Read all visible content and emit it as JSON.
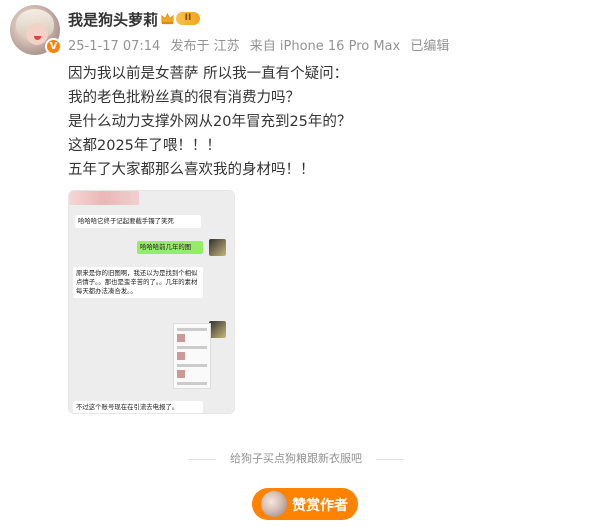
{
  "post": {
    "author": "我是狗头萝莉",
    "level_badge": "II",
    "verified_badge": "V",
    "meta": {
      "time": "25-1-17 07:14",
      "location": "发布于 江苏",
      "source": "来自 iPhone 16 Pro Max",
      "edited": "已编辑"
    },
    "text_lines": [
      "因为我以前是女菩萨 所以我一直有个疑问：",
      "我的老色批粉丝真的很有消费力吗？",
      "是什么动力支撑外网从20年冒充到25年的？",
      "这都2025年了喂！！！",
      "五年了大家都那么喜欢我的身材吗！！"
    ],
    "image_chat": {
      "msg1": "哈哈哈它终于记起要截手镯了笑死",
      "msg2": "哈哈哈前几年的图",
      "msg3": "原来是你的旧图啊，我还以为是找到个相似点情子。。那也是蛮辛苦的了。。几年的素材每天都办法凑合发。。",
      "msg4": "不过这个账号现在在引流去电报了。"
    }
  },
  "reward": {
    "divider_text": "给狗子买点狗粮跟新衣服吧",
    "button_label": "赞赏作者"
  },
  "colors": {
    "accent": "#ff8200",
    "meta_text": "#939393",
    "body_text": "#333333"
  }
}
